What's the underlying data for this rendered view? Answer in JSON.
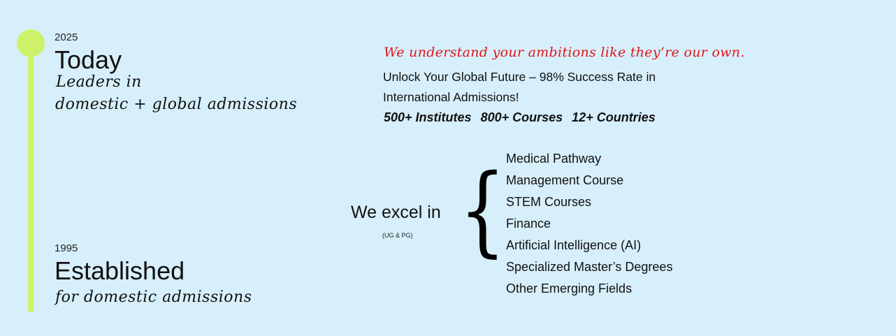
{
  "timeline": {
    "today": {
      "year": "2025",
      "title": "Today",
      "line1": "Leaders in",
      "line2": "domestic + global admissions"
    },
    "established": {
      "year": "1995",
      "title": "Established",
      "line1": "for domestic admissions"
    }
  },
  "hero": {
    "tagline": "We understand your ambitions like they’re our own.",
    "description": "Unlock Your Global Future – 98% Success Rate in International Admissions!",
    "stats": [
      "500+ Institutes",
      "800+ Courses",
      "12+ Countries"
    ]
  },
  "excel": {
    "label": "We excel in",
    "sublabel": "(UG & PG)",
    "brace": "{",
    "courses": [
      "Medical Pathway",
      "Management Course",
      "STEM Courses",
      "Finance",
      "Artificial Intelligence (AI)",
      "Specialized Master’s Degrees",
      "Other Emerging Fields"
    ]
  },
  "colors": {
    "background": "#d7effa",
    "timeline": "#cdf26a",
    "tagline": "#e0151b"
  }
}
